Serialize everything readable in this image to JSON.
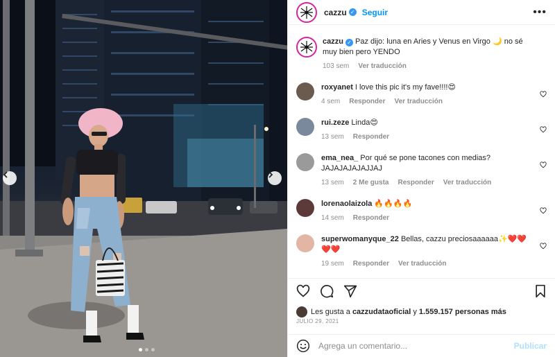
{
  "post": {
    "username": "cazzu",
    "follow_label": "Seguir",
    "more_label": "•••"
  },
  "caption": {
    "username": "cazzu",
    "text": "Paz dijo: luna en Aries y Venus en Virgo 🌙 no sé muy bien pero YENDO",
    "age": "103 sem",
    "translate": "Ver traducción"
  },
  "comments": [
    {
      "username": "roxyanet",
      "text": "I love this pic it's my fave!!!!😍",
      "age": "4 sem",
      "actions": [
        "Responder",
        "Ver traducción"
      ],
      "avatar_color": "#6b5a4e"
    },
    {
      "username": "rui.zeze",
      "text": "Linda😍",
      "age": "13 sem",
      "actions": [
        "Responder"
      ],
      "avatar_color": "#7a8a9c"
    },
    {
      "username": "ema_nea_",
      "text": "Por qué se pone tacones con medias? JAJAJAJAJAJJAJ",
      "age": "13 sem",
      "actions": [
        "2 Me gusta",
        "Responder",
        "Ver traducción"
      ],
      "avatar_color": "#9a9a9a"
    },
    {
      "username": "lorenaolaizola",
      "text": "🔥🔥🔥🔥",
      "age": "14 sem",
      "actions": [
        "Responder"
      ],
      "avatar_color": "#5c3a3a"
    },
    {
      "username": "superwomanyque_22",
      "text": "Bellas, cazzu preciosaaaaaa✨❤️❤️❤️❤️",
      "age": "19 sem",
      "actions": [
        "Responder",
        "Ver traducción"
      ],
      "avatar_color": "#e3b5a4"
    }
  ],
  "likes": {
    "prefix": "Les gusta a",
    "user": "cazzudataoficial",
    "connector": "y",
    "count": "1.559.157 personas más"
  },
  "date": "JULIO 29, 2021",
  "comment_input": {
    "placeholder": "Agrega un comentario...",
    "publish_label": "Publicar"
  },
  "icons": {
    "like": "heart-icon",
    "comment": "comment-icon",
    "share": "share-icon",
    "save": "bookmark-icon",
    "emoji": "emoji-icon",
    "prev": "chevron-left-icon",
    "next": "chevron-right-icon"
  },
  "colors": {
    "follow": "#0095f6",
    "verified": "#3897f0",
    "publish_disabled": "#b2dffc",
    "muted": "#8e8e8e"
  },
  "carousel": {
    "slides": 3,
    "active": 1
  }
}
